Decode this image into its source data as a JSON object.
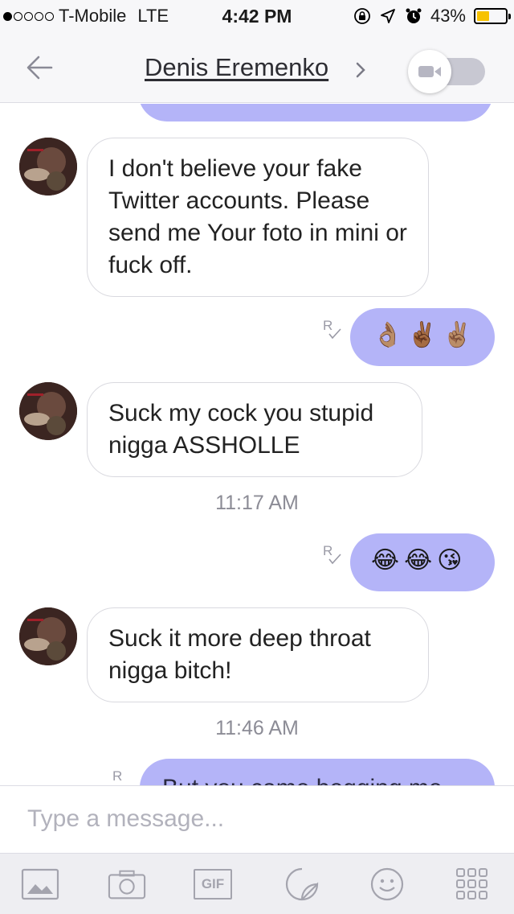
{
  "status_bar": {
    "carrier": "T-Mobile",
    "network": "LTE",
    "time": "4:42 PM",
    "battery_percent": "43%",
    "battery_level": 0.43,
    "signal_bars_filled": 1,
    "signal_bars_total": 5,
    "battery_color": "#f7c200"
  },
  "nav": {
    "contact_name": "Denis Eremenko",
    "back_icon": "arrow-left-icon",
    "chevron_icon": "chevron-right-icon",
    "video_icon": "video-camera-icon"
  },
  "messages": [
    {
      "type": "outgoing",
      "text": "",
      "partial": "top"
    },
    {
      "type": "incoming",
      "text": "I don't believe your fake Twitter accounts. Please send me Your foto in mini or fuck off."
    },
    {
      "type": "outgoing",
      "emojis": [
        "👌🏽",
        "✌🏾",
        "✌🏽"
      ],
      "receipt": "R"
    },
    {
      "type": "incoming",
      "text": "Suck my cock you stupid nigga ASSHOLLE"
    },
    {
      "type": "timestamp",
      "text": "11:17 AM"
    },
    {
      "type": "outgoing",
      "emojis": [
        "😂",
        "😂",
        "😘"
      ],
      "receipt": "R"
    },
    {
      "type": "incoming",
      "text": "Suck it more deep throat nigga bitch!"
    },
    {
      "type": "timestamp",
      "text": "11:46 AM"
    },
    {
      "type": "outgoing",
      "text": "But you came begging me",
      "receipt": "R",
      "partial": "bottom"
    }
  ],
  "input": {
    "placeholder": "Type a message..."
  },
  "toolbar": {
    "items": [
      {
        "icon": "image-icon"
      },
      {
        "icon": "camera-icon"
      },
      {
        "icon": "gif-icon",
        "label": "GIF"
      },
      {
        "icon": "sticker-icon"
      },
      {
        "icon": "emoji-icon"
      },
      {
        "icon": "more-apps-icon"
      }
    ]
  },
  "colors": {
    "outgoing_bubble": "#b4b4f8",
    "incoming_border": "#d9d9df",
    "nav_background": "#f7f7f9",
    "toolbar_background": "#eeeef2"
  }
}
